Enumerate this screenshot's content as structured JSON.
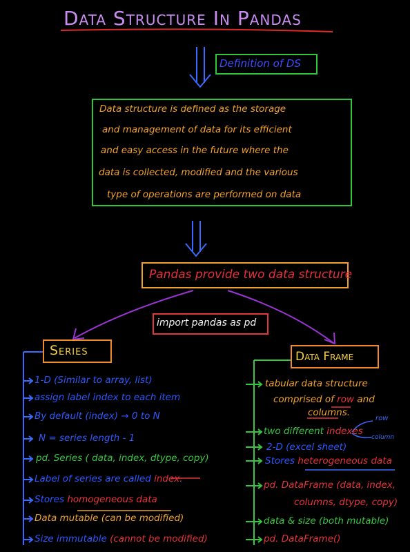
{
  "title": "Data Structure In Pandas",
  "definition_label": "Definition of DS",
  "definition_paragraph": [
    "Data structure is defined as the storage",
    "and management of data for its efficient",
    "and easy access in the future where the",
    "data is collected, modified and the various",
    "type of operations are performed on data"
  ],
  "pandas_statement": "Pandas provide two data structure",
  "import_statement": "import pandas as pd",
  "series": {
    "heading": "Series",
    "items": [
      {
        "text": "1-D (Similar to array, list)",
        "color": "#2b59ff"
      },
      {
        "text": "assign label index to each item",
        "color": "#2b59ff"
      },
      {
        "text": "By default (index) → 0 to N",
        "color": "#2b59ff"
      },
      {
        "text": "N = series length - 1",
        "color": "#2b59ff"
      },
      {
        "text": "pd. Series ( data, index, dtype, copy)",
        "color": "#36c83e"
      },
      {
        "pre": "Label of series are called ",
        "em": "index.",
        "pre_color": "#2b59ff",
        "em_color": "#e8333a"
      },
      {
        "pre": "Stores ",
        "em": "homogeneous data",
        "pre_color": "#2b59ff",
        "em_color": "#e8333a"
      },
      {
        "text": "Data mutable (can be modified)",
        "color": "#f0a22e"
      },
      {
        "pre": "Size immutable ",
        "em": "(cannot be modified)",
        "pre_color": "#2b59ff",
        "em_color": "#e8333a"
      }
    ]
  },
  "dataframe": {
    "heading": "Data Frame",
    "items": [
      {
        "text": "tabular data structure",
        "color": "#f0a22e"
      },
      {
        "pre": "comprised of ",
        "em": "row",
        "post": " and",
        "pre_color": "#f0a22e",
        "em_color": "#e8333a"
      },
      {
        "text": "columns.",
        "color": "#f0a22e"
      },
      {
        "pre": "two different ",
        "em": "indexes",
        "pre_color": "#36c83e",
        "em_color": "#e8333a"
      },
      {
        "text": "2-D (excel sheet)",
        "color": "#2b59ff"
      },
      {
        "pre": "Stores ",
        "em": "heterogeneous data",
        "pre_color": "#2b59ff",
        "em_color": "#e8333a"
      },
      {
        "text": "pd. DataFrame (data, index,",
        "color": "#e8333a"
      },
      {
        "text": "columns, dtype, copy)",
        "color": "#e8333a"
      },
      {
        "text": "data & size (both mutable)",
        "color": "#36c83e"
      },
      {
        "text": "pd. DataFrame()",
        "color": "#e8333a"
      }
    ],
    "index_annotations": {
      "row": "row",
      "column": "column"
    }
  },
  "colors": {
    "background": "#000000",
    "title": "#c98cf0",
    "green_box": "#2fc83a",
    "blue": "#2b59ff",
    "orange": "#f0a22e",
    "red": "#e8333a",
    "purple_arrow": "#9b35d6",
    "yellow": "#f4cf44"
  }
}
